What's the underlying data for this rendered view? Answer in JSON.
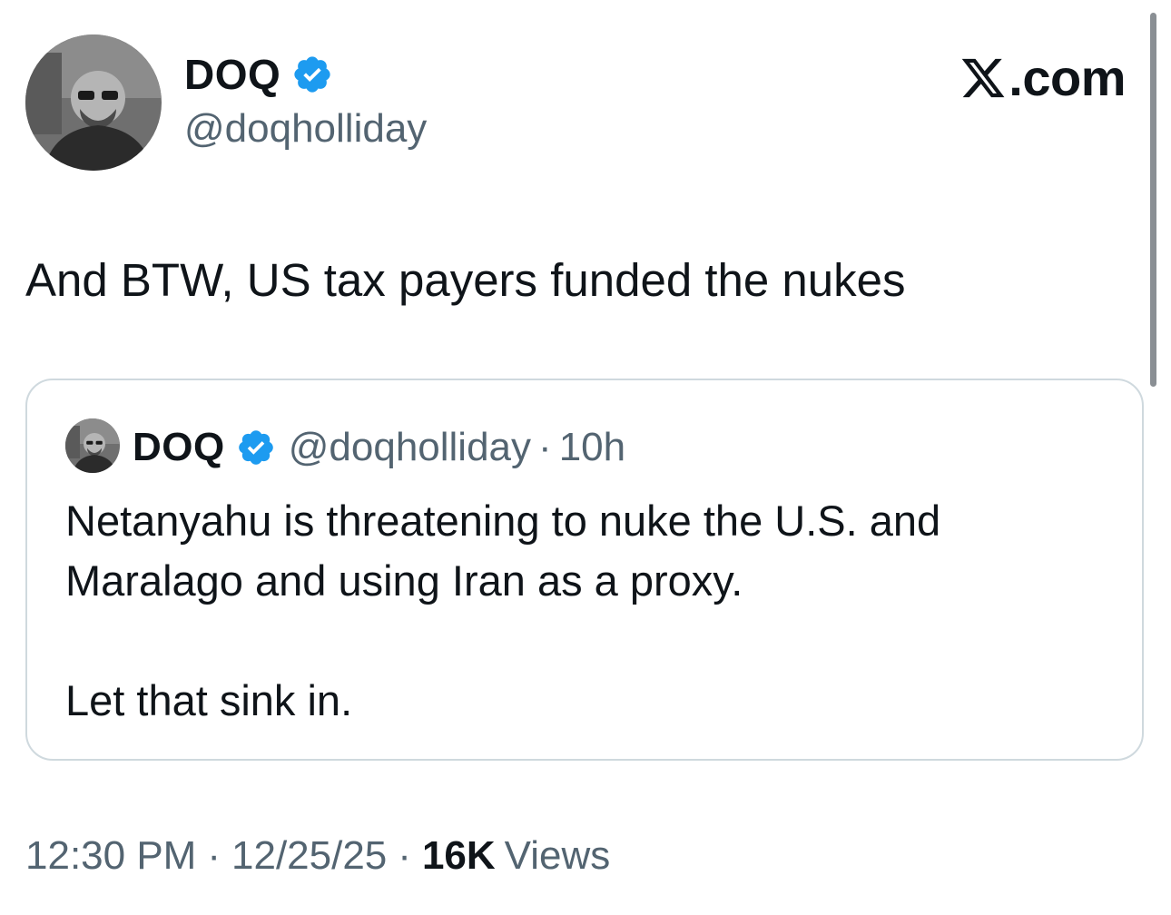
{
  "tweet": {
    "author": {
      "name": "DOQ",
      "handle": "@doqholliday",
      "verified": true
    },
    "brand": {
      "logo": "x-logo-icon",
      "suffix": ".com"
    },
    "text": "And BTW, US tax payers funded the nukes",
    "quote": {
      "author_name": "DOQ",
      "handle": "@doqholliday",
      "separator": "·",
      "time": "10h",
      "lines": [
        "Netanyahu is threatening to nuke the U.S. and",
        "Maralago and using Iran as a proxy.",
        "Let that sink in."
      ]
    },
    "meta": {
      "time": "12:30 PM",
      "separator": "·",
      "date": "12/25/25",
      "views_count": "16K",
      "views_label": "Views"
    }
  },
  "colors": {
    "text_primary": "#0f1419",
    "text_secondary": "#536471",
    "verified_blue": "#1d9bf0",
    "border": "#cfd9de"
  }
}
